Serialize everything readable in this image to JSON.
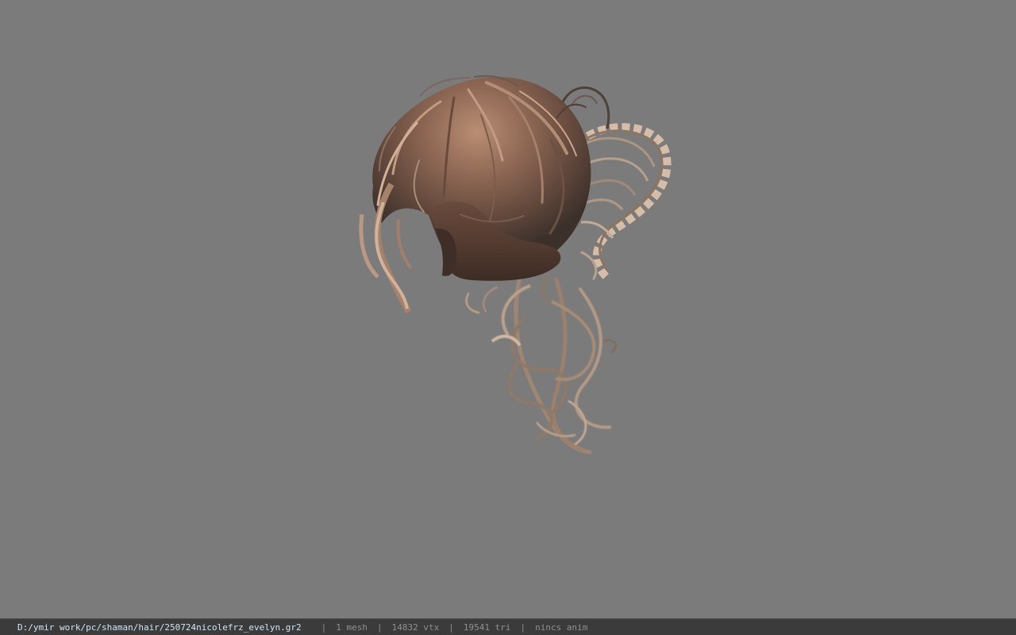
{
  "viewer": {
    "background_color": "#7b7b7b",
    "model_name": "250724nicolefrz_evelyn"
  },
  "status_bar": {
    "file_path": "D:/ymir work/pc/shaman/hair/250724nicolefrz_evelyn.gr2",
    "separator": "|",
    "mesh_count": "1 mesh",
    "vertex_count": "14832 vtx",
    "triangle_count": "19541 tri",
    "anim_status": "nincs anim",
    "path_color": "#cfe7f6",
    "bar_color": "#3b3b3b"
  }
}
